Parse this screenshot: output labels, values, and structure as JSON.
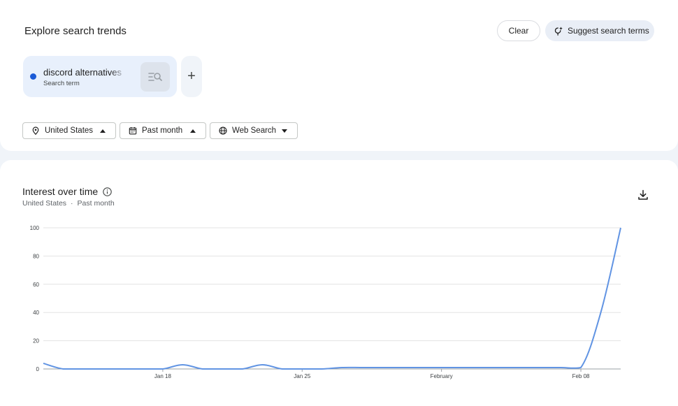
{
  "header": {
    "title": "Explore search trends",
    "clear_label": "Clear",
    "suggest_label": "Suggest search terms"
  },
  "term": {
    "name": "discord alternatives",
    "type": "Search term",
    "color": "#1a5ad6",
    "add_label": "+"
  },
  "filters": {
    "region": "United States",
    "time": "Past month",
    "type": "Web Search"
  },
  "chart_section": {
    "title": "Interest over time",
    "sub_region": "United States",
    "sub_sep": "·",
    "sub_time": "Past month"
  },
  "chart_data": {
    "type": "line",
    "title": "Interest over time",
    "xlabel": "",
    "ylabel": "",
    "ylim": [
      0,
      100
    ],
    "yticks": [
      0,
      20,
      40,
      60,
      80,
      100
    ],
    "x_tick_labels": [
      {
        "label": "Jan 18",
        "index": 6
      },
      {
        "label": "Jan 25",
        "index": 13
      },
      {
        "label": "February",
        "index": 20
      },
      {
        "label": "Feb 08",
        "index": 27
      }
    ],
    "grid": true,
    "legend": "none",
    "series": [
      {
        "color": "#6194e3",
        "values": [
          4,
          0,
          0,
          0,
          0,
          0,
          0,
          3,
          0,
          0,
          0,
          3,
          0,
          0,
          0,
          1,
          1,
          1,
          1,
          1,
          1,
          1,
          1,
          1,
          1,
          1,
          1,
          1,
          40,
          100
        ]
      }
    ]
  }
}
